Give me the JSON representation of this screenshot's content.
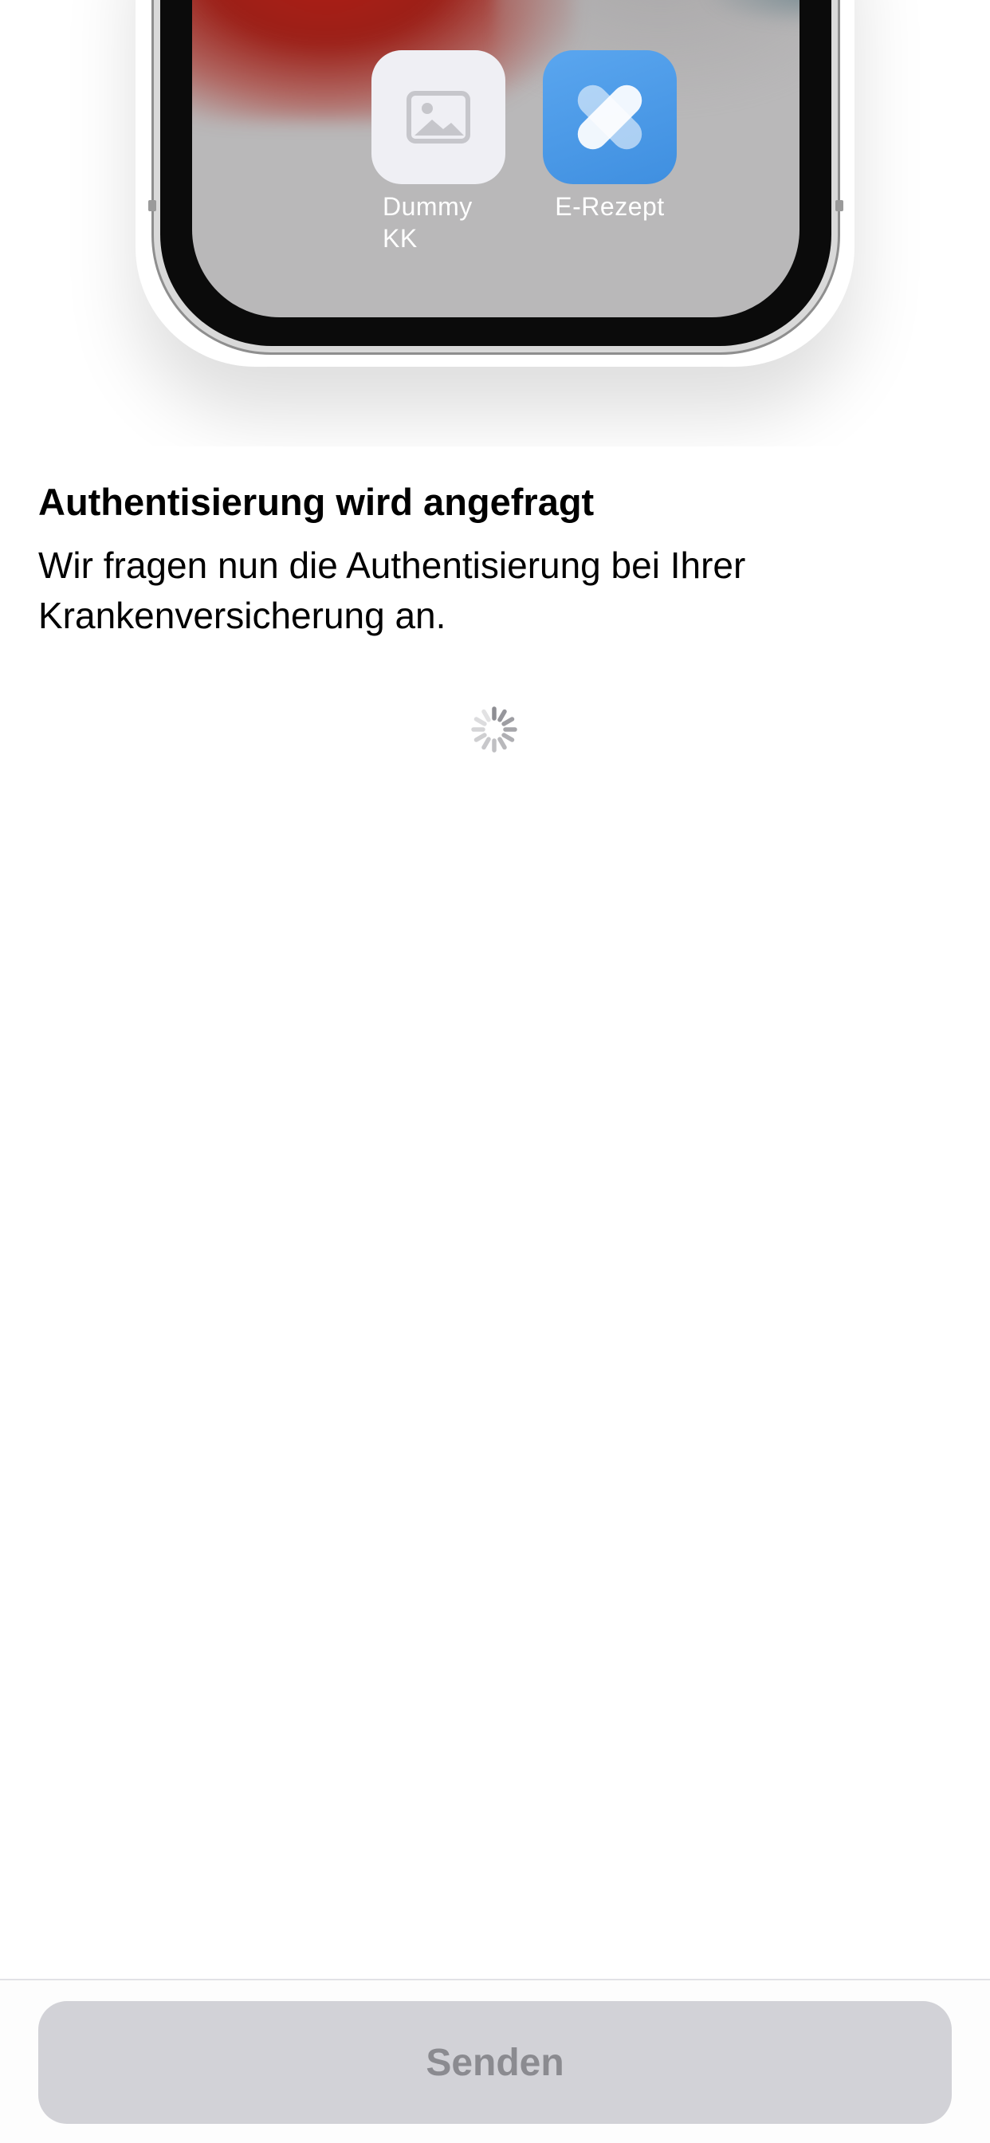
{
  "illustration": {
    "apps": [
      {
        "label": "Dummy KK",
        "icon": "image-placeholder-icon"
      },
      {
        "label": "E-Rezept",
        "icon": "e-rezept-app-icon"
      }
    ]
  },
  "main": {
    "title": "Authentisierung wird angefragt",
    "description": "Wir fragen nun die Authentisierung bei Ihrer Krankenversicherung an.",
    "loading_indicator": "activity-spinner-icon"
  },
  "footer": {
    "send_label": "Senden",
    "send_enabled": false
  },
  "colors": {
    "button_disabled_bg": "#d2d2d7",
    "button_disabled_text": "#8b8b90",
    "erezept_blue": "#4a9be8"
  }
}
